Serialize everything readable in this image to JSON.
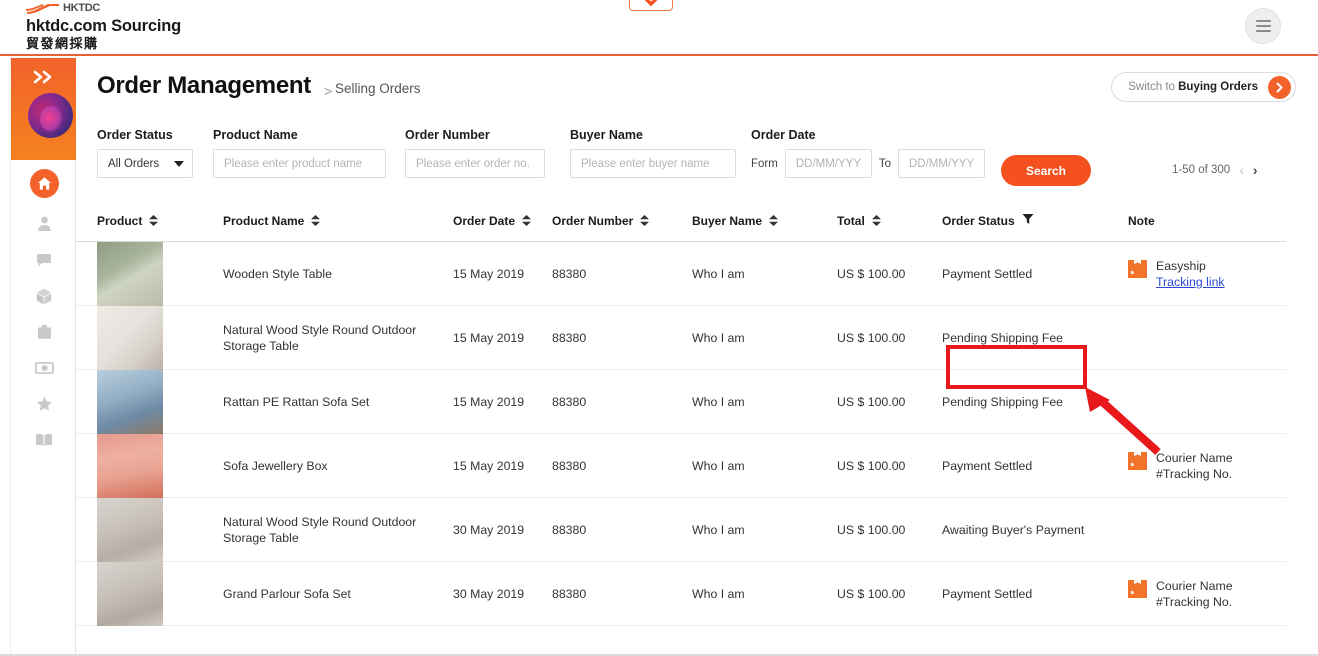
{
  "topbar": {
    "logo_word": "HKTDC",
    "brand_name": "hktdc.com Sourcing",
    "brand_cn": "貿發網採購",
    "chevron_icon": "chevron-down-icon",
    "menu_icon": "hamburger-menu-icon"
  },
  "sidebar": {
    "expand_icon": "double-chevron-right-icon",
    "avatar": "user-avatar",
    "items": [
      {
        "icon": "home-icon",
        "name": "sidebar-item-home",
        "active": true
      },
      {
        "icon": "person-icon",
        "name": "sidebar-item-profile",
        "active": false
      },
      {
        "icon": "chat-icon",
        "name": "sidebar-item-messages",
        "active": false
      },
      {
        "icon": "cube-icon",
        "name": "sidebar-item-products",
        "active": false
      },
      {
        "icon": "briefcase-icon",
        "name": "sidebar-item-business",
        "active": false
      },
      {
        "icon": "cash-icon",
        "name": "sidebar-item-payments",
        "active": false
      },
      {
        "icon": "star-icon",
        "name": "sidebar-item-favourites",
        "active": false
      },
      {
        "icon": "book-icon",
        "name": "sidebar-item-catalogue",
        "active": false
      }
    ]
  },
  "page": {
    "title": "Order Management",
    "breadcrumb_separator": ">",
    "breadcrumb": "Selling Orders",
    "switch_prefix": "Switch to ",
    "switch_strong": "Buying Orders",
    "switch_arrow_icon": "chevron-right-icon"
  },
  "filters": {
    "order_status": {
      "label": "Order Status",
      "value": "All Orders",
      "caret_icon": "caret-down-icon"
    },
    "product_name": {
      "label": "Product Name",
      "value": "",
      "placeholder": "Please enter product name"
    },
    "order_number": {
      "label": "Order Number",
      "value": "",
      "placeholder": "Please enter order no."
    },
    "buyer_name": {
      "label": "Buyer Name",
      "value": "",
      "placeholder": "Please enter buyer name"
    },
    "order_date": {
      "label": "Order Date",
      "from_word": "Form",
      "to_word": "To",
      "from_value": "",
      "from_placeholder": "DD/MM/YYY",
      "to_value": "",
      "to_placeholder": "DD/MM/YYY"
    },
    "search_button": "Search"
  },
  "pagination": {
    "range_text": "1-50 of 300",
    "prev_icon": "chevron-left-icon",
    "next_icon": "chevron-right-icon"
  },
  "table": {
    "columns": [
      {
        "label": "Product",
        "sortable": true,
        "filterable": false
      },
      {
        "label": "Product Name",
        "sortable": true,
        "filterable": false
      },
      {
        "label": "Order Date",
        "sortable": true,
        "filterable": false
      },
      {
        "label": "Order Number",
        "sortable": true,
        "filterable": false
      },
      {
        "label": "Buyer Name",
        "sortable": true,
        "filterable": false
      },
      {
        "label": "Total",
        "sortable": true,
        "filterable": false
      },
      {
        "label": "Order Status",
        "sortable": false,
        "filterable": true
      },
      {
        "label": "Note",
        "sortable": false,
        "filterable": false
      }
    ],
    "rows": [
      {
        "product_name": "Wooden Style Table",
        "order_date": "15 May 2019",
        "order_number": "88380",
        "buyer_name": "Who I am",
        "total": "US $ 100.00",
        "order_status": "Payment Settled",
        "note_line1": "Easyship",
        "note_line2": "Tracking link",
        "note_link": true,
        "note_icon": "package-box-icon"
      },
      {
        "product_name": "Natural Wood Style Round Outdoor Storage Table",
        "order_date": "15 May 2019",
        "order_number": "88380",
        "buyer_name": "Who I am",
        "total": "US $ 100.00",
        "order_status": "Pending Shipping Fee",
        "note_line1": "",
        "note_line2": "",
        "note_link": false,
        "note_icon": ""
      },
      {
        "product_name": "Rattan PE Rattan Sofa Set",
        "order_date": "15 May 2019",
        "order_number": "88380",
        "buyer_name": "Who I am",
        "total": "US $ 100.00",
        "order_status": "Pending Shipping Fee",
        "note_line1": "",
        "note_line2": "",
        "note_link": false,
        "note_icon": ""
      },
      {
        "product_name": "Sofa Jewellery Box",
        "order_date": "15 May 2019",
        "order_number": "88380",
        "buyer_name": "Who I am",
        "total": "US $ 100.00",
        "order_status": "Payment Settled",
        "note_line1": "Courier Name",
        "note_line2": "#Tracking No.",
        "note_link": false,
        "note_icon": "package-box-icon"
      },
      {
        "product_name": "Natural Wood Style Round Outdoor Storage Table",
        "order_date": "30 May 2019",
        "order_number": "88380",
        "buyer_name": "Who I am",
        "total": "US $ 100.00",
        "order_status": "Awaiting Buyer's Payment",
        "note_line1": "",
        "note_line2": "",
        "note_link": false,
        "note_icon": ""
      },
      {
        "product_name": "Grand Parlour Sofa Set",
        "order_date": "30 May 2019",
        "order_number": "88380",
        "buyer_name": "Who I am",
        "total": "US $ 100.00",
        "order_status": "Payment Settled",
        "note_line1": "Courier Name",
        "note_line2": "#Tracking No.",
        "note_link": false,
        "note_icon": "package-box-icon"
      }
    ]
  },
  "annotation": {
    "highlight_target": "Pending Shipping Fee",
    "highlight_color": "#e8191b",
    "arrow_color": "#e8191b"
  },
  "colors": {
    "brand_orange": "#f2622a",
    "search_orange": "#f4511e",
    "link_blue": "#2a4ad7",
    "annotation_red": "#e8191b"
  }
}
